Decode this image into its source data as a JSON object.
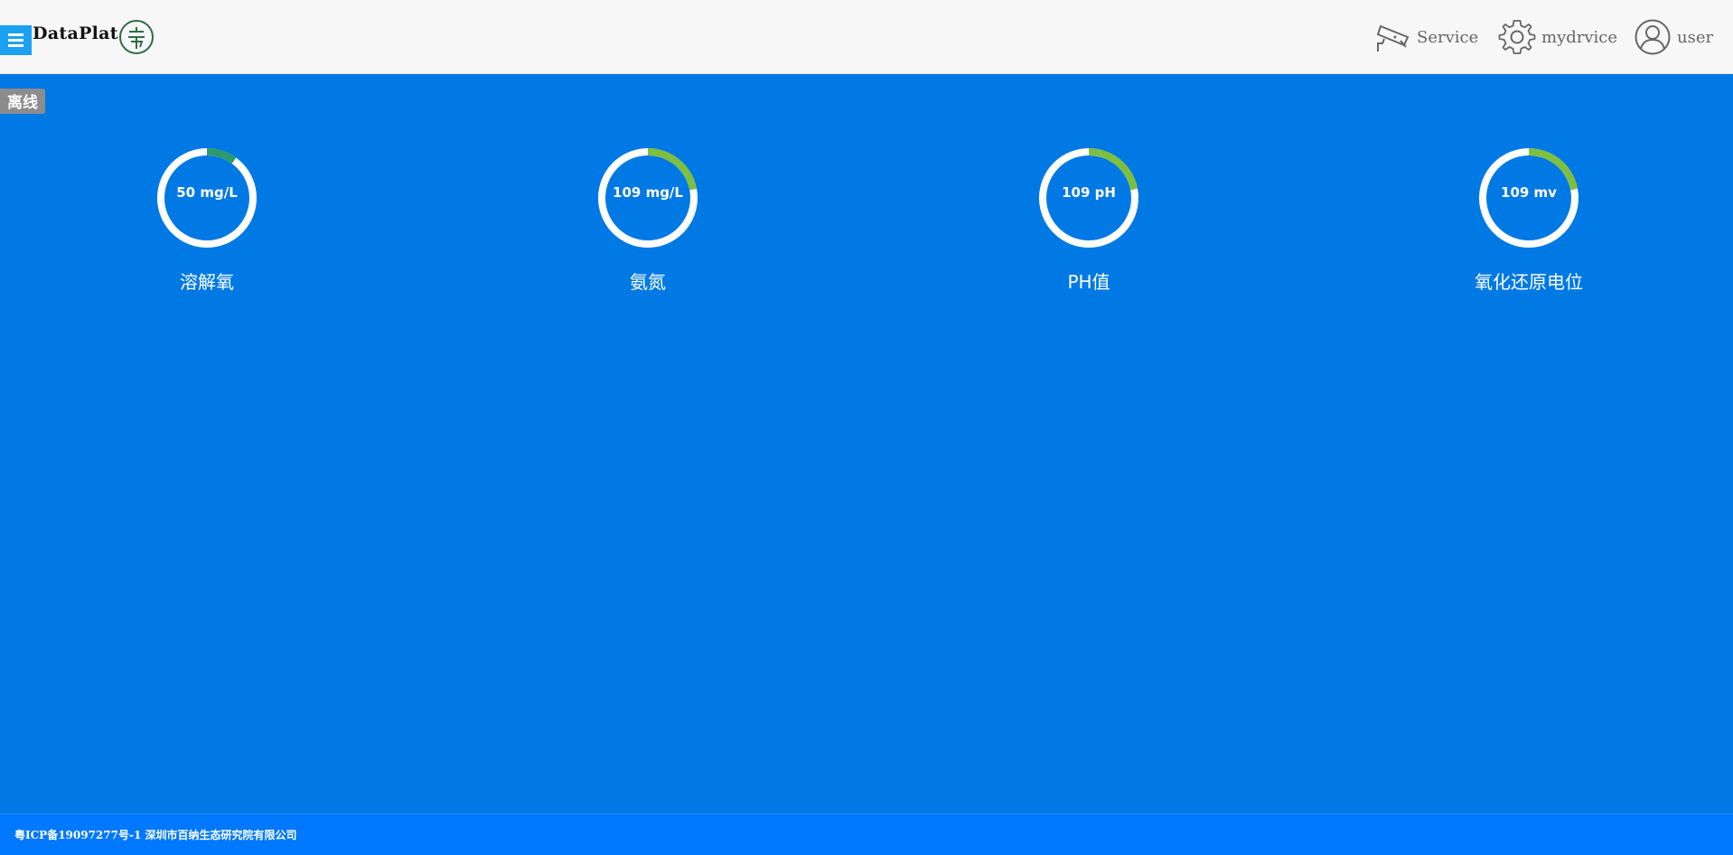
{
  "header": {
    "brand": "DataPlat",
    "nav": [
      {
        "label": "Service",
        "icon": "camera-icon"
      },
      {
        "label": "mydrvice",
        "icon": "gear-icon"
      },
      {
        "label": "user",
        "icon": "user-icon"
      }
    ]
  },
  "status_badge": "离线",
  "gauges": [
    {
      "value_text": "50 mg/L",
      "label": "溶解氧",
      "fraction": 0.1,
      "color": "#2e9a6a"
    },
    {
      "value_text": "109 mg/L",
      "label": "氨氮",
      "fraction": 0.22,
      "color": "#7fbf3f"
    },
    {
      "value_text": "109 pH",
      "label": "PH值",
      "fraction": 0.22,
      "color": "#7fbf3f"
    },
    {
      "value_text": "109 mv",
      "label": "氧化还原电位",
      "fraction": 0.22,
      "color": "#7fbf3f"
    }
  ],
  "footer": {
    "text": "粤ICP备19097277号-1 深圳市百纳生态研究院有限公司"
  },
  "colors": {
    "background": "#0079e5",
    "menu_button": "#1ba1f2",
    "footer": "#0078ff",
    "gauge_track": "#ffffff"
  }
}
